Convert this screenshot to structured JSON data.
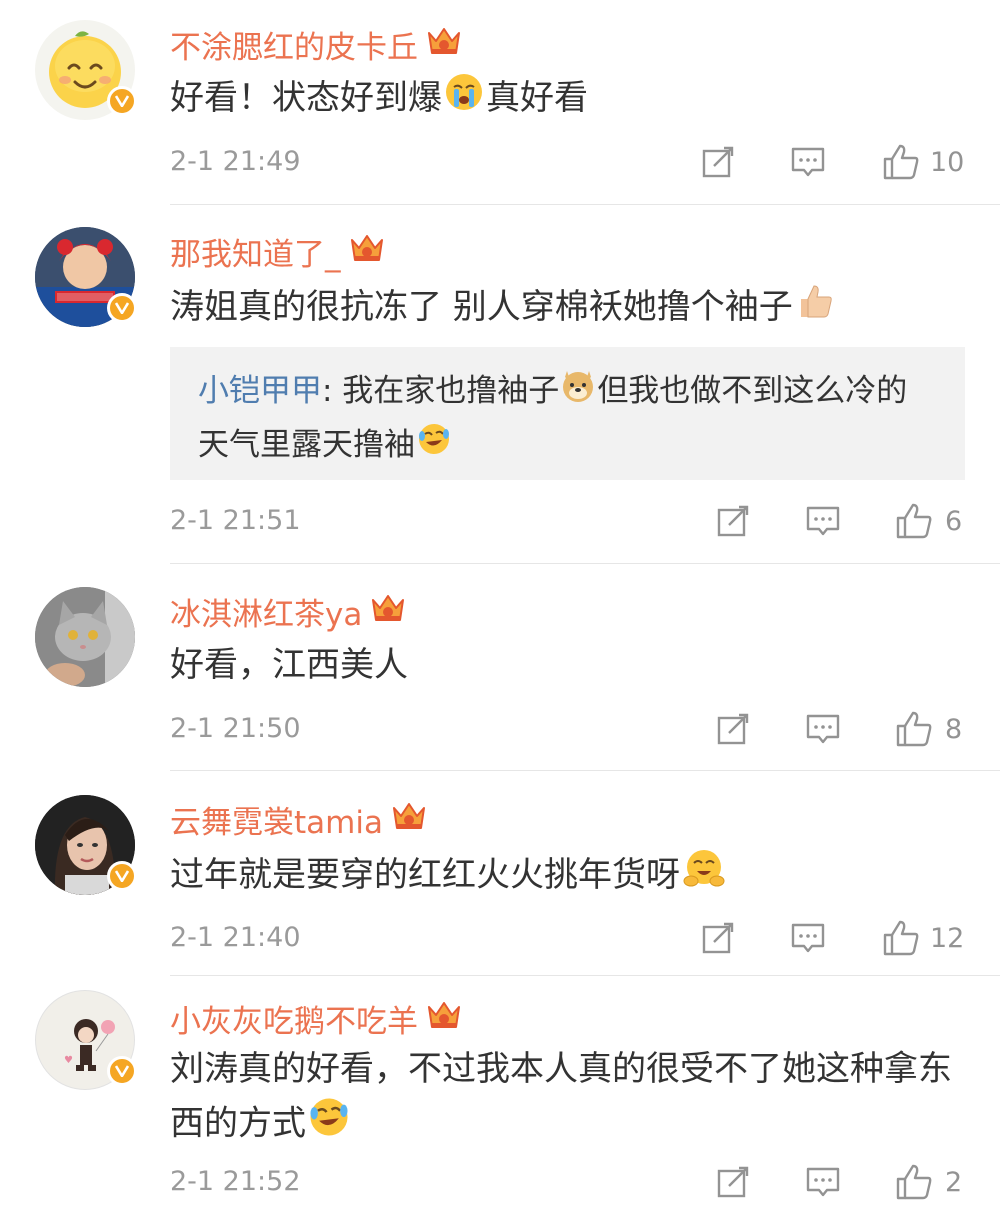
{
  "comments": [
    {
      "username": "不涂腮红的皮卡丘",
      "text_a": "好看！状态好到爆",
      "emoji_a": "crying-face",
      "text_b": "真好看",
      "time": "2-1 21:49",
      "likes": "10"
    },
    {
      "username": "那我知道了_",
      "text_a": "涛姐真的很抗冻了 别人穿棉袄她撸个袖子",
      "emoji_a": "thumbs-up",
      "reply": {
        "name": "小铠甲甲",
        "sep": ":",
        "text_a": " 我在家也撸袖子",
        "emoji_a": "doge",
        "text_b": "但我也做不到这么冷的天气里露天撸袖",
        "emoji_b": "laugh-cry"
      },
      "time": "2-1 21:51",
      "likes": "6"
    },
    {
      "username": "冰淇淋红茶ya",
      "text_a": "好看，江西美人",
      "time": "2-1 21:50",
      "likes": "8"
    },
    {
      "username": "云舞霓裳tamia",
      "text_a": "过年就是要穿的红红火火挑年货呀",
      "emoji_a": "hug-face",
      "time": "2-1 21:40",
      "likes": "12"
    },
    {
      "username": "小灰灰吃鹅不吃羊",
      "text_a": "刘涛真的好看，不过我本人真的很受不了她这种拿东西的方式",
      "emoji_a": "laugh-cry",
      "time": "2-1 21:52",
      "likes": "2"
    }
  ],
  "icons": {
    "repost": "repost-icon",
    "comment": "comment-icon",
    "like": "like-icon",
    "vip": "crown-icon",
    "verified": "verified-badge-icon"
  },
  "colors": {
    "username": "#eb7350",
    "reply_name": "#507daf",
    "text": "#333333",
    "meta": "#9a9a9a",
    "badge": "#f5a623"
  }
}
